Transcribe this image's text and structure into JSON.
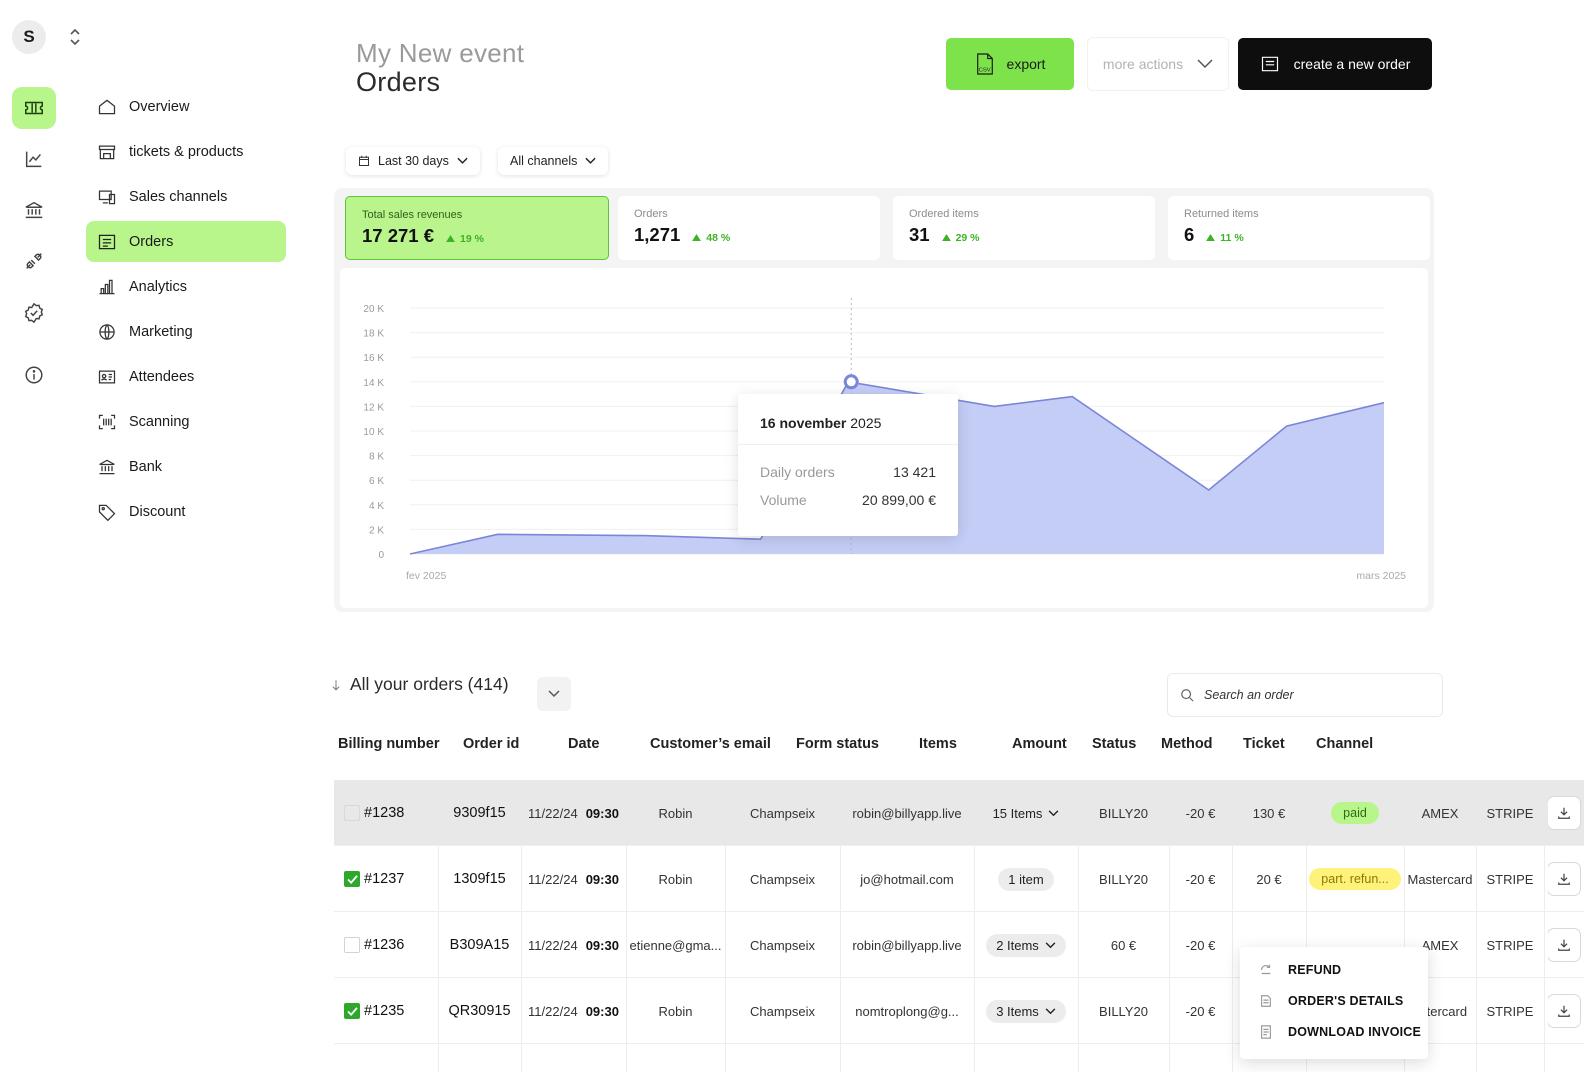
{
  "workspace": {
    "avatar_letter": "S"
  },
  "rail": {
    "items": [
      {
        "icon": "ticket-icon",
        "active": true
      },
      {
        "icon": "trend-chart-icon",
        "active": false
      },
      {
        "icon": "bank-icon",
        "active": false
      },
      {
        "icon": "plug-icon",
        "active": false
      },
      {
        "icon": "verified-badge-icon",
        "active": false
      },
      {
        "icon": "info-icon",
        "active": false
      }
    ]
  },
  "nav": {
    "items": [
      {
        "label": "Overview",
        "icon": "home-icon"
      },
      {
        "label": "tickets & products",
        "icon": "store-icon"
      },
      {
        "label": "Sales channels",
        "icon": "devices-icon"
      },
      {
        "label": "Orders",
        "icon": "receipt-icon",
        "active": true
      },
      {
        "label": "Analytics",
        "icon": "bar-chart-icon"
      },
      {
        "label": "Marketing",
        "icon": "globe-icon"
      },
      {
        "label": "Attendees",
        "icon": "id-card-icon"
      },
      {
        "label": "Scanning",
        "icon": "barcode-scan-icon"
      },
      {
        "label": "Bank",
        "icon": "bank-icon"
      },
      {
        "label": "Discount",
        "icon": "tag-icon"
      }
    ]
  },
  "header": {
    "event_name": "My New event",
    "page_title": "Orders",
    "export_label": "export",
    "export_icon_text": "CSV",
    "more_actions_label": "more actions",
    "create_order_label": "create a new order"
  },
  "filters": {
    "period": "Last 30 days",
    "channel": "All channels"
  },
  "stats": [
    {
      "label": "Total sales revenues",
      "value": "17 271 €",
      "delta": "19 %"
    },
    {
      "label": "Orders",
      "value": "1,271",
      "delta": "48 %"
    },
    {
      "label": "Ordered items",
      "value": "31",
      "delta": "29 %"
    },
    {
      "label": "Returned items",
      "value": "6",
      "delta": "11 %"
    }
  ],
  "chart_data": {
    "type": "area",
    "y_ticks": [
      "0",
      "2 K",
      "4 K",
      "6 K",
      "8 K",
      "10 K",
      "12 K",
      "14 K",
      "16 K",
      "18 K",
      "20 K"
    ],
    "ylim": [
      0,
      20000
    ],
    "x_start_label": "fev 2025",
    "x_end_label": "mars 2025",
    "x": [
      0,
      0.09,
      0.24,
      0.36,
      0.45,
      0.6,
      0.68,
      0.82,
      0.9,
      1.0
    ],
    "values": [
      0,
      1600,
      1500,
      1200,
      14000,
      12000,
      12800,
      5200,
      10400,
      12300
    ],
    "color": "#c4cdf6",
    "line_color": "#7b86d8",
    "tooltip": {
      "date_bold": "16 november",
      "date_rest": "2025",
      "rows": [
        {
          "label": "Daily orders",
          "value": "13 421"
        },
        {
          "label": "Volume",
          "value": "20 899,00 €"
        }
      ]
    }
  },
  "orders": {
    "title": "All your orders (414)",
    "search_placeholder": "Search an order",
    "columns": [
      "Billing number",
      "Order id",
      "Date",
      "Customer’s email",
      "Form status",
      "Items",
      "Amount",
      "Status",
      "Method",
      "Ticket",
      "Channel"
    ],
    "rows": [
      {
        "checked": false,
        "billing": "#1238",
        "order_id": "9309f15",
        "date": "11/22/24",
        "time": "09:30",
        "first": "Robin",
        "last": "Champseix",
        "email": "robin@billyapp.live",
        "items": "15 Items",
        "items_dropdown": true,
        "code": "BILLY20",
        "discount": "-20 €",
        "amount": "130 €",
        "status": "paid",
        "status_type": "paid",
        "method": "AMEX",
        "processor": "STRIPE"
      },
      {
        "checked": true,
        "billing": "#1237",
        "order_id": "1309f15",
        "date": "11/22/24",
        "time": "09:30",
        "first": "Robin",
        "last": "Champseix",
        "email": "jo@hotmail.com",
        "items": "1 item",
        "items_dropdown": false,
        "code": "BILLY20",
        "discount": "-20 €",
        "amount": "20 €",
        "status": "part. refun...",
        "status_type": "partial",
        "method": "Mastercard",
        "processor": "STRIPE"
      },
      {
        "checked": false,
        "billing": "#1236",
        "order_id": "B309A15",
        "date": "11/22/24",
        "time": "09:30",
        "first": "etienne@gma...",
        "last": "Champseix",
        "email": "robin@billyapp.live",
        "items": "2 Items",
        "items_dropdown": true,
        "code": "60 €",
        "discount": "-20 €",
        "amount": "",
        "status": "",
        "status_type": "hidden",
        "method": "AMEX",
        "processor": "STRIPE"
      },
      {
        "checked": true,
        "billing": "#1235",
        "order_id": "QR30915",
        "date": "11/22/24",
        "time": "09:30",
        "first": "Robin",
        "last": "Champseix",
        "email": "nomtroplong@g...",
        "items": "3 Items",
        "items_dropdown": true,
        "code": "BILLY20",
        "discount": "-20 €",
        "amount": "",
        "status": "",
        "status_type": "hidden",
        "method": "astercard",
        "processor": "STRIPE"
      }
    ]
  },
  "context_menu": {
    "items": [
      {
        "label": "REFUND",
        "icon": "refund-arrow-icon"
      },
      {
        "label": "ORDER'S DETAILS",
        "icon": "document-icon"
      },
      {
        "label": "DOWNLOAD INVOICE",
        "icon": "invoice-icon"
      }
    ]
  }
}
